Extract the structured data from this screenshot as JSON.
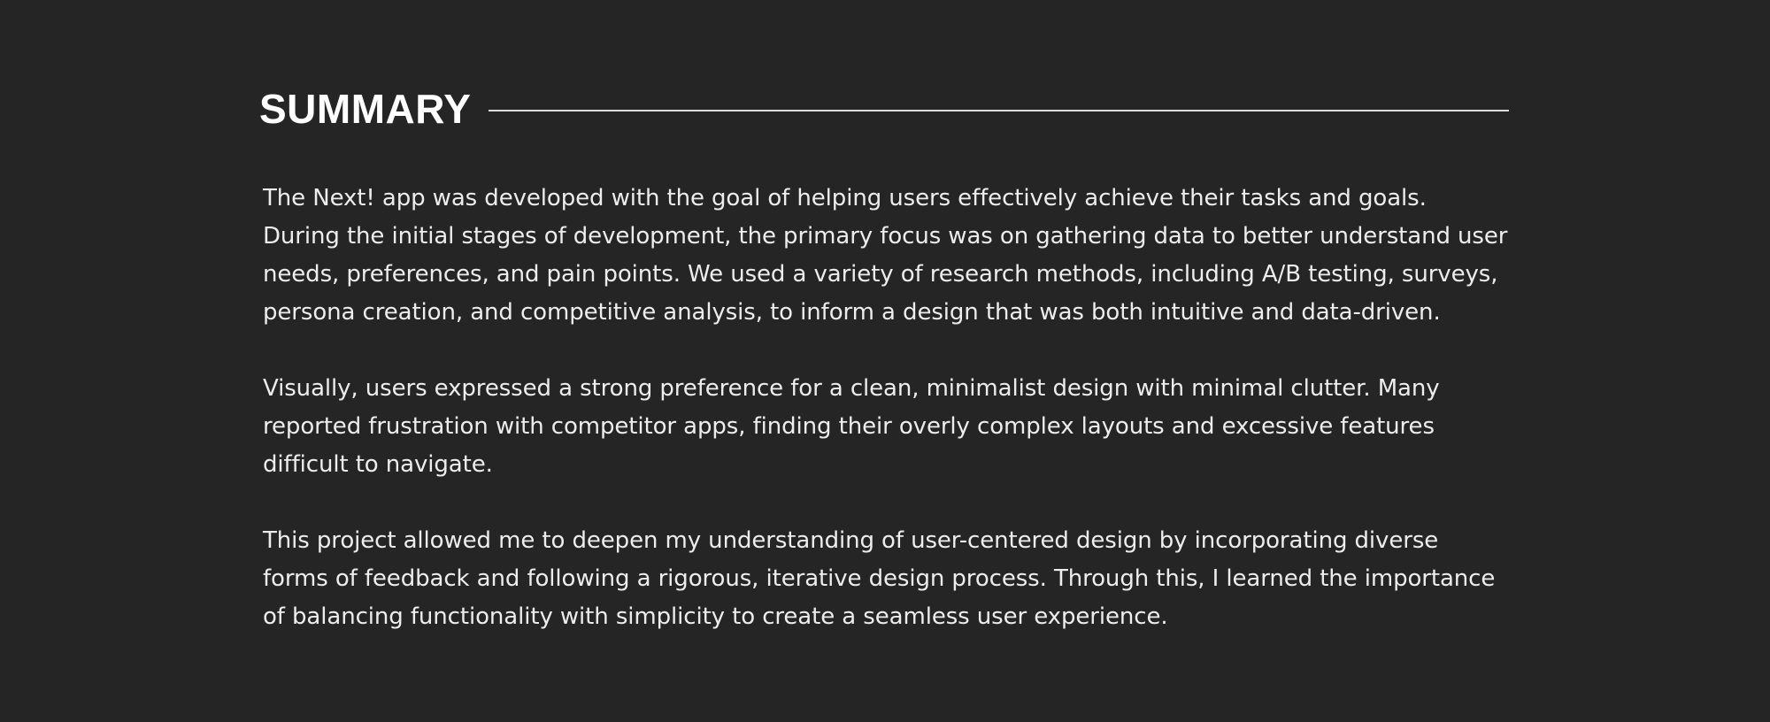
{
  "summary": {
    "title": "SUMMARY",
    "paragraphs": [
      "The Next! app was developed with the goal of helping users effectively achieve their tasks and goals. During the initial stages of development, the primary focus was on gathering data to better understand user needs, preferences, and pain points. We used a variety of research methods, including A/B testing, surveys, persona creation, and competitive analysis, to inform a design that was both intuitive and data-driven.",
      "Visually, users expressed a strong preference for a clean, minimalist design with minimal clutter. Many reported frustration with competitor apps, finding their overly complex layouts and excessive features difficult to navigate.",
      "This project allowed me to deepen my understanding of user-centered design by incorporating diverse forms of feedback and following a rigorous, iterative design process. Through this, I learned the importance of balancing functionality with simplicity to create a seamless user experience."
    ]
  },
  "colors": {
    "background": "#252525",
    "text": "#ededed",
    "rule": "#dedede"
  }
}
